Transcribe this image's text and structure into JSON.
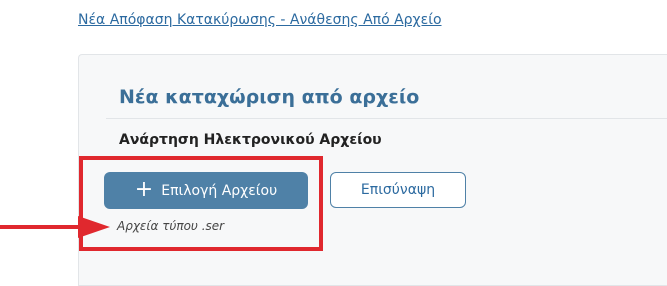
{
  "header": {
    "link_text": "Νέα Απόφαση Κατακύρωσης - Ανάθεσης Από Αρχείο"
  },
  "panel": {
    "title": "Νέα καταχώριση από αρχείο",
    "section_label": "Ανάρτηση Ηλεκτρονικού Αρχείου",
    "select_button": {
      "icon": "plus-icon",
      "label": "Επιλογή Αρχείου"
    },
    "attach_button": {
      "label": "Επισύναψη"
    },
    "hint": "Αρχεία τύπου .ser"
  },
  "annotation": {
    "icon": "arrow-right-icon"
  },
  "colors": {
    "link": "#2c6aa0",
    "title": "#3b6f98",
    "primary_button": "#4f81a7",
    "highlight": "#e0282e",
    "panel_background": "#f7f8f9"
  }
}
